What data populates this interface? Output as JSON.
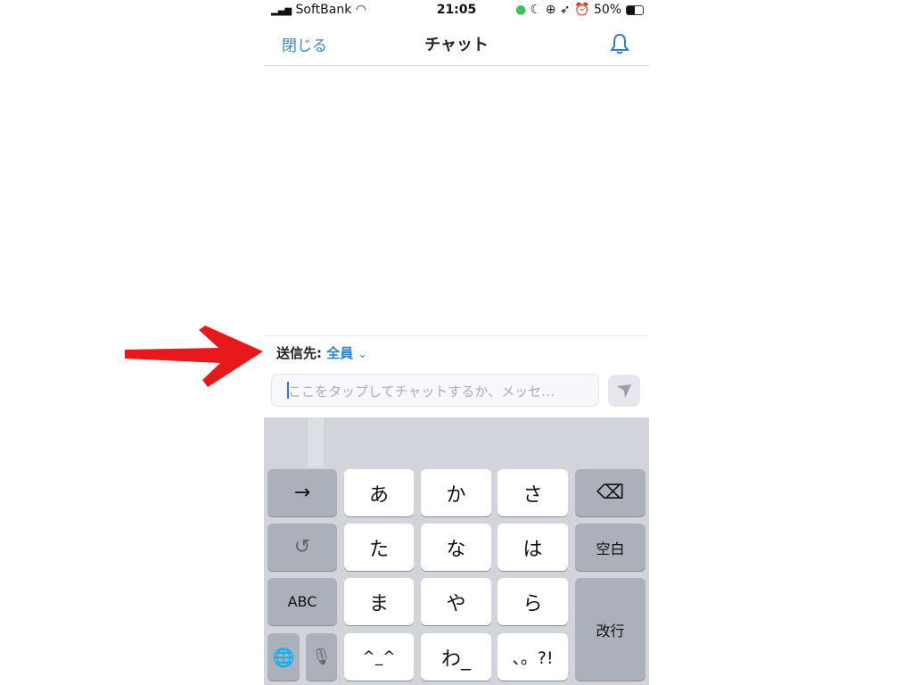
{
  "status_bar": {
    "carrier": "SoftBank",
    "time": "21:05",
    "battery": "50%"
  },
  "nav": {
    "close_label": "閉じる",
    "title": "チャット",
    "bell_icon": "bell-icon"
  },
  "chat": {
    "to_label": "送信先:",
    "to_value": "全員",
    "input_placeholder": "ここをタップしてチャットするか、メッセ…"
  },
  "keyboard": {
    "arrow": "→",
    "undo": "↺",
    "abc": "ABC",
    "globe": "globe-icon",
    "mic": "mic-icon",
    "kana": [
      "あ",
      "か",
      "さ",
      "た",
      "な",
      "は",
      "ま",
      "や",
      "ら",
      "^_^",
      "わ_",
      "、。?!"
    ],
    "backspace": "⌫",
    "space": "空白",
    "enter": "改行"
  },
  "colors": {
    "accent": "#2d7fd0",
    "annotation_arrow": "#e8191c",
    "keyboard_bg": "#d1d4db"
  }
}
